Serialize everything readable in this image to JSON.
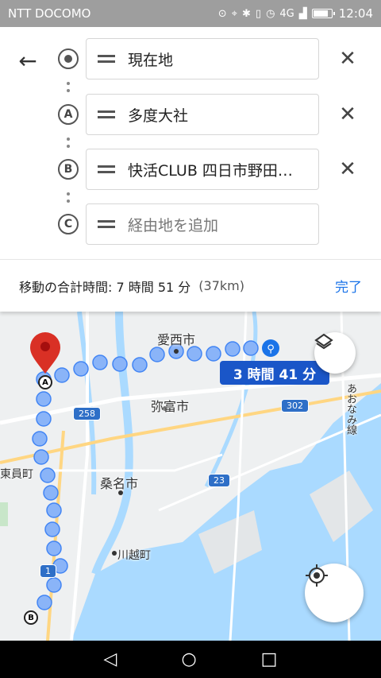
{
  "status_bar": {
    "carrier": "NTT DOCOMO",
    "network": "4G",
    "battery_level": 0.85,
    "time": "12:04"
  },
  "directions": {
    "back_icon": "arrow-left-icon",
    "origin": {
      "marker": "current-location-icon",
      "value": "現在地"
    },
    "stop_a": {
      "marker": "A",
      "value": "多度大社"
    },
    "stop_b": {
      "marker": "B",
      "value": "快活CLUB 四日市野田…"
    },
    "add_stop": {
      "marker": "C",
      "placeholder": "経由地を追加"
    },
    "remove_icon": "close-icon",
    "drag_icon": "drag-handle-icon"
  },
  "summary": {
    "label": "移動の合計時間: 7 時間 51 分",
    "distance": "(37km)",
    "done": "完了"
  },
  "map": {
    "places": {
      "aisai": "愛西市",
      "yatomi": "弥富市",
      "kuwana": "桑名市",
      "kawagoe": "川越町",
      "toin": "東員町",
      "oominami": "あおなみ線"
    },
    "roads": {
      "r258": "258",
      "r302": "302",
      "r23": "23",
      "r1": "1"
    },
    "route_time": "3 時間 41 分",
    "route_color": "#8ab4f8",
    "pin_color": "#d93025",
    "marker_a": "A",
    "marker_b": "B",
    "layers_icon": "layers-icon",
    "locate_icon": "my-location-icon",
    "walk_icon": "walking-icon"
  },
  "nav_bar": {
    "back_icon": "triangle-back-icon",
    "home_icon": "circle-home-icon",
    "recents_icon": "square-recents-icon"
  }
}
